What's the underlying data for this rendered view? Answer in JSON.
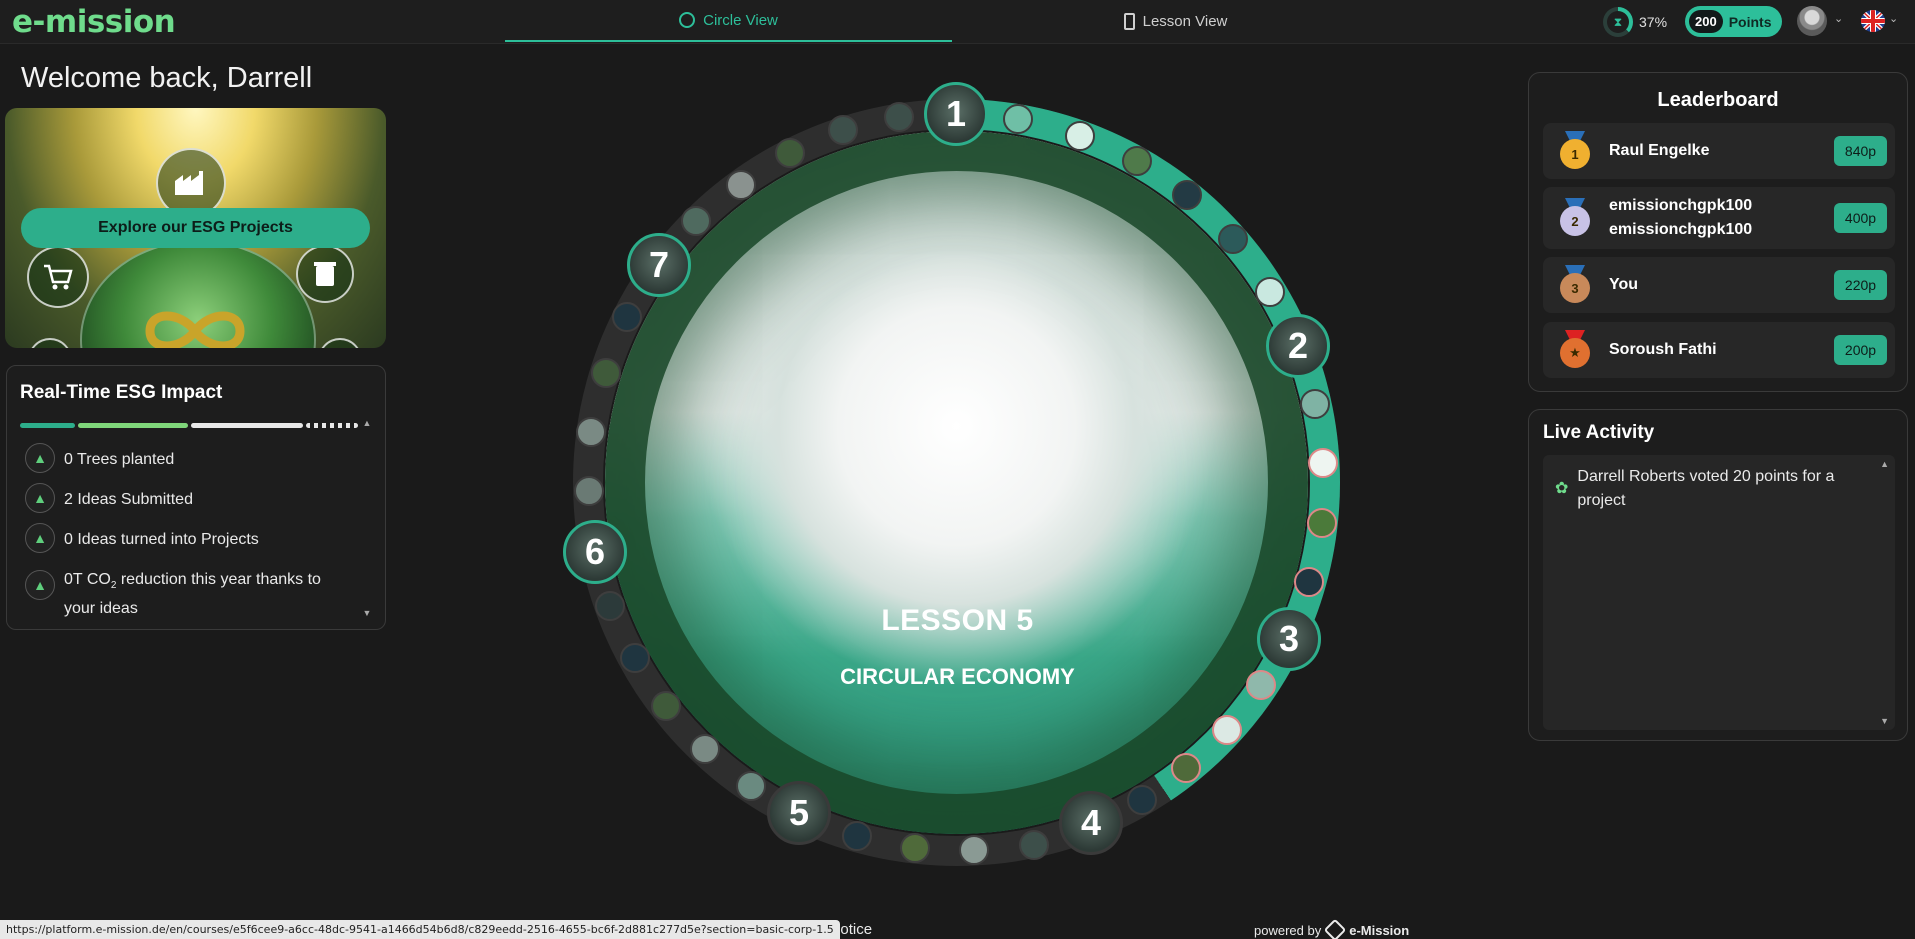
{
  "header": {
    "logo_text": "e-mission",
    "tabs": [
      {
        "label": "Circle View",
        "active": true
      },
      {
        "label": "Lesson View",
        "active": false
      }
    ],
    "progress_percent_label": "37%",
    "progress_value": 0.37,
    "points_value": "200",
    "points_label": "Points",
    "language_flag": "uk-flag-icon"
  },
  "sidebar": {
    "welcome": "Welcome back, Darrell",
    "esg_button": "Explore our ESG Projects",
    "impact": {
      "title": "Real-Time ESG Impact",
      "items": [
        {
          "text": "0 Trees planted"
        },
        {
          "text": "2 Ideas Submitted"
        },
        {
          "text": "0 Ideas turned into Projects"
        },
        {
          "text_pre": "0T CO",
          "sub": "2",
          "text_post": " reduction this year thanks to your ideas"
        }
      ]
    }
  },
  "circle": {
    "lesson_title": "LESSON 5",
    "lesson_subtitle": "CIRCULAR ECONOMY",
    "nodes": [
      "1",
      "2",
      "3",
      "4",
      "5",
      "6",
      "7"
    ]
  },
  "leaderboard": {
    "title": "Leaderboard",
    "rows": [
      {
        "rank": "1",
        "name": "Raul Engelke",
        "points": "840p",
        "medal_color": "#f0b030"
      },
      {
        "rank": "2",
        "name": "emissionchgpk100\nemissionchgpk100",
        "points": "400p",
        "medal_color": "#c8c2e6"
      },
      {
        "rank": "3",
        "name": "You",
        "points": "220p",
        "medal_color": "#c8895a"
      },
      {
        "rank": "★",
        "name": "Soroush Fathi",
        "points": "200p",
        "medal_color": "#e07030"
      }
    ]
  },
  "live_activity": {
    "title": "Live Activity",
    "items": [
      {
        "text": "Darrell Roberts voted 20 points for a project"
      }
    ]
  },
  "footer": {
    "status_url": "https://platform.e-mission.de/en/courses/e5f6cee9-a6cc-48dc-9541-a1466d54b6d8/c829eedd-2516-4655-bc6f-2d881c277d5e?section=basic-corp-1.5",
    "legal": "egal Notice",
    "powered_by": "powered by",
    "brand": "e-Mission"
  },
  "colors": {
    "accent": "#2dae8b",
    "logo": "#6fdc8c",
    "background": "#1a1a1a"
  }
}
